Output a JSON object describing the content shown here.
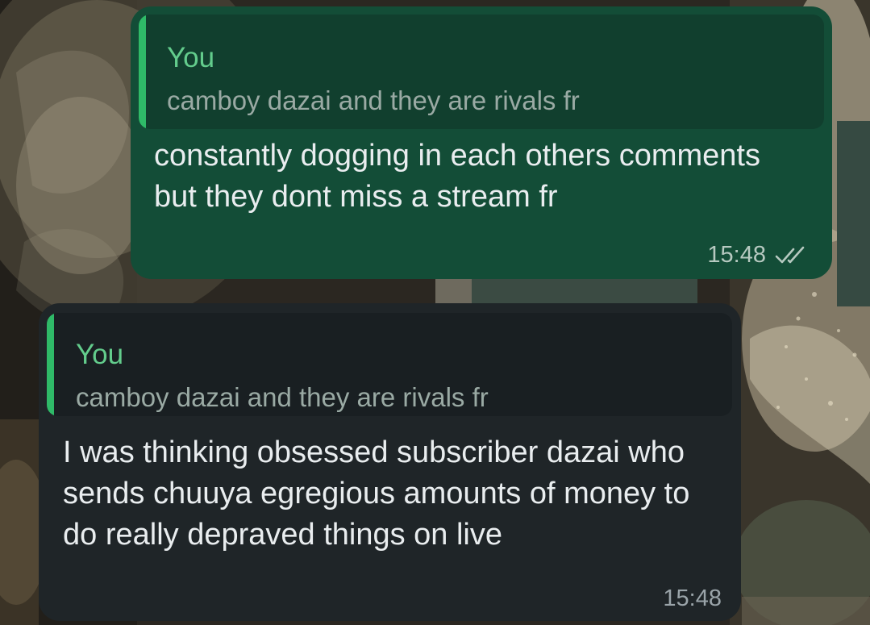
{
  "colors": {
    "outgoing_bubble": "#134d37",
    "outgoing_quote_bg": "#113f2e",
    "incoming_bubble": "#1f2528",
    "incoming_quote_bg": "#191f22",
    "quote_accent": "#2fba68",
    "quote_author": "#63cc8c",
    "quote_text": "#9aaaa4",
    "message_text": "#e9edef",
    "time_outgoing": "#b6c9c0",
    "time_incoming": "#9aa4a9",
    "read_ticks": "#b6c9c0"
  },
  "messages": [
    {
      "direction": "outgoing",
      "quote": {
        "author": "You",
        "text": "camboy dazai and they are rivals fr"
      },
      "text": "constantly dogging in each others comments but they dont miss a stream fr",
      "time": "15:48",
      "status_icon": "double-check-icon"
    },
    {
      "direction": "incoming",
      "quote": {
        "author": "You",
        "text": "camboy dazai and they are rivals fr"
      },
      "text": "I was thinking obsessed subscriber dazai who sends chuuya egregious amounts of money to do really depraved things on live",
      "time": "15:48"
    }
  ]
}
